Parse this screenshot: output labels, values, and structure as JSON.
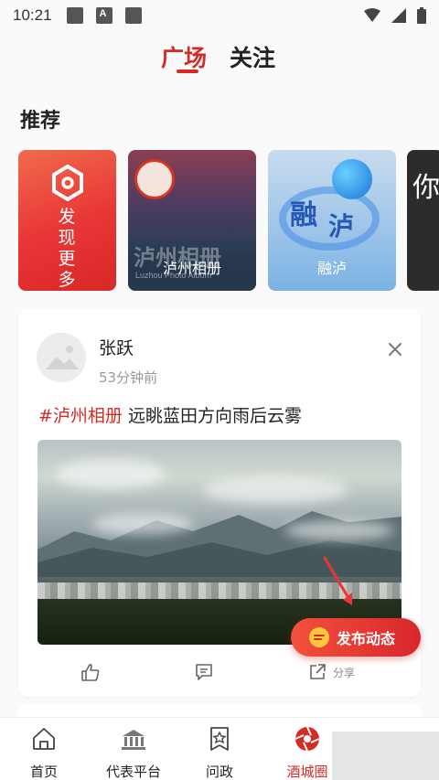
{
  "status_bar": {
    "time": "10:21"
  },
  "header": {
    "tabs": [
      {
        "label": "广场",
        "active": true
      },
      {
        "label": "关注",
        "active": false
      }
    ]
  },
  "recommend": {
    "title": "推荐",
    "cards": [
      {
        "label": "发现更多",
        "type": "discover"
      },
      {
        "label": "泸州相册",
        "overlay_big": "泸州相册",
        "overlay_small": "Luzhou Photo Album"
      },
      {
        "label": "融泸",
        "overlay_big": "融",
        "overlay_big2": "泸"
      },
      {
        "label": "",
        "overlay": "你"
      }
    ]
  },
  "post": {
    "author": "张跃",
    "time": "53分钟前",
    "tag": "#泸州相册",
    "text": "远眺蓝田方向雨后云雾",
    "actions": {
      "share_label": "分享"
    }
  },
  "fab": {
    "label": "发布动态"
  },
  "tabbar": {
    "items": [
      {
        "label": "首页",
        "icon": "home-icon"
      },
      {
        "label": "代表平台",
        "icon": "building-icon"
      },
      {
        "label": "问政",
        "icon": "star-badge-icon"
      },
      {
        "label": "酒城圈",
        "icon": "aperture-icon",
        "active": true
      }
    ]
  },
  "colors": {
    "accent": "#d62b24"
  }
}
